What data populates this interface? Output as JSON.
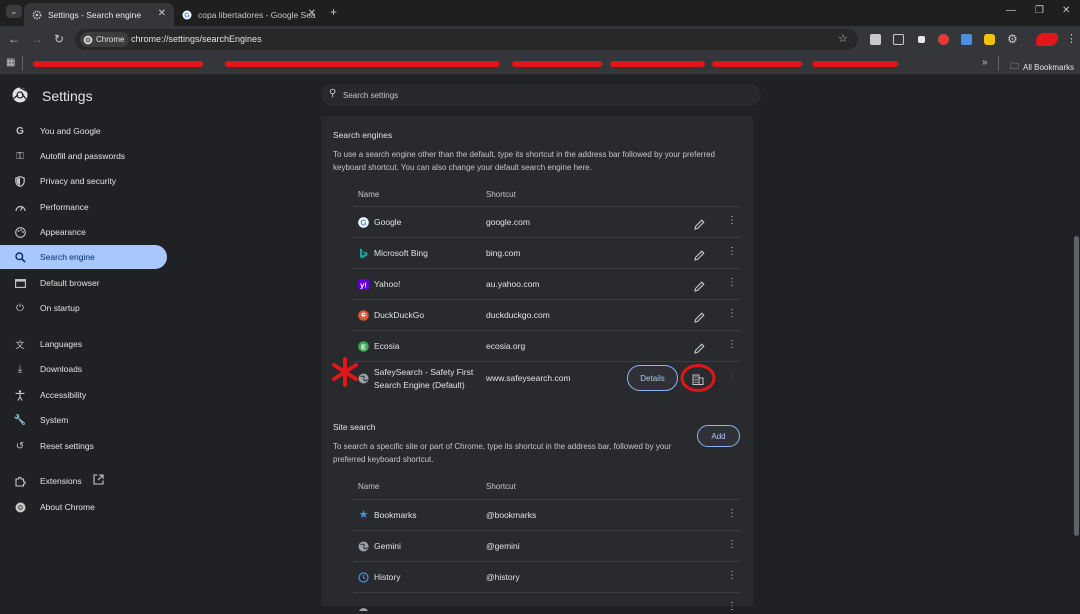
{
  "browser": {
    "tabs": [
      {
        "title": "Settings - Search engine",
        "active": true
      },
      {
        "title": "copa libertadores - Google Sear",
        "active": false
      }
    ],
    "omnibox": {
      "chip_label": "Chrome",
      "url": "chrome://settings/searchEngines"
    },
    "bookmarks": {
      "all_bookmarks_label": "All Bookmarks"
    }
  },
  "settings": {
    "title": "Settings",
    "search_placeholder": "Search settings",
    "nav": [
      {
        "label": "You and Google",
        "icon": "google-g-icon"
      },
      {
        "label": "Autofill and passwords",
        "icon": "key-icon"
      },
      {
        "label": "Privacy and security",
        "icon": "shield-icon"
      },
      {
        "label": "Performance",
        "icon": "speedometer-icon"
      },
      {
        "label": "Appearance",
        "icon": "palette-icon"
      },
      {
        "label": "Search engine",
        "icon": "search-icon",
        "selected": true
      },
      {
        "label": "Default browser",
        "icon": "browser-window-icon"
      },
      {
        "label": "On startup",
        "icon": "power-icon"
      },
      {
        "label": "Languages",
        "icon": "translate-icon"
      },
      {
        "label": "Downloads",
        "icon": "download-icon"
      },
      {
        "label": "Accessibility",
        "icon": "accessibility-icon"
      },
      {
        "label": "System",
        "icon": "wrench-icon"
      },
      {
        "label": "Reset settings",
        "icon": "reset-icon"
      },
      {
        "label": "Extensions",
        "icon": "puzzle-icon"
      },
      {
        "label": "About Chrome",
        "icon": "chrome-icon"
      }
    ]
  },
  "search_engines": {
    "title": "Search engines",
    "description": "To use a search engine other than the default, type its shortcut in the address bar followed by your preferred keyboard shortcut. You can also change your default search engine here.",
    "col_name": "Name",
    "col_shortcut": "Shortcut",
    "rows": [
      {
        "name": "Google",
        "shortcut": "google.com",
        "icon": "google-icon",
        "color": "#4285f4"
      },
      {
        "name": "Microsoft Bing",
        "shortcut": "bing.com",
        "icon": "bing-icon",
        "color": "#0f8a8a"
      },
      {
        "name": "Yahoo!",
        "shortcut": "au.yahoo.com",
        "icon": "yahoo-icon",
        "color": "#6001d2"
      },
      {
        "name": "DuckDuckGo",
        "shortcut": "duckduckgo.com",
        "icon": "duckduckgo-icon",
        "color": "#de5833"
      },
      {
        "name": "Ecosia",
        "shortcut": "ecosia.org",
        "icon": "ecosia-icon",
        "color": "#36a854"
      },
      {
        "name_line1": "SafeySearch - Safety First",
        "name_line2": "Search Engine (Default)",
        "shortcut": "www.safeysearch.com",
        "icon": "globe-icon"
      }
    ],
    "details_label": "Details"
  },
  "site_search": {
    "title": "Site search",
    "description": "To search a specific site or part of Chrome, type its shortcut in the address bar, followed by your preferred keyboard shortcut.",
    "add_label": "Add",
    "col_name": "Name",
    "col_shortcut": "Shortcut",
    "rows": [
      {
        "name": "Bookmarks",
        "shortcut": "@bookmarks",
        "icon": "star-icon"
      },
      {
        "name": "Gemini",
        "shortcut": "@gemini",
        "icon": "globe-icon"
      },
      {
        "name": "History",
        "shortcut": "@history",
        "icon": "history-icon"
      }
    ]
  },
  "colors": {
    "accent": "#a8c7fa",
    "annotation_red": "#e0161b",
    "background": "#202124",
    "card": "#282a2d"
  }
}
